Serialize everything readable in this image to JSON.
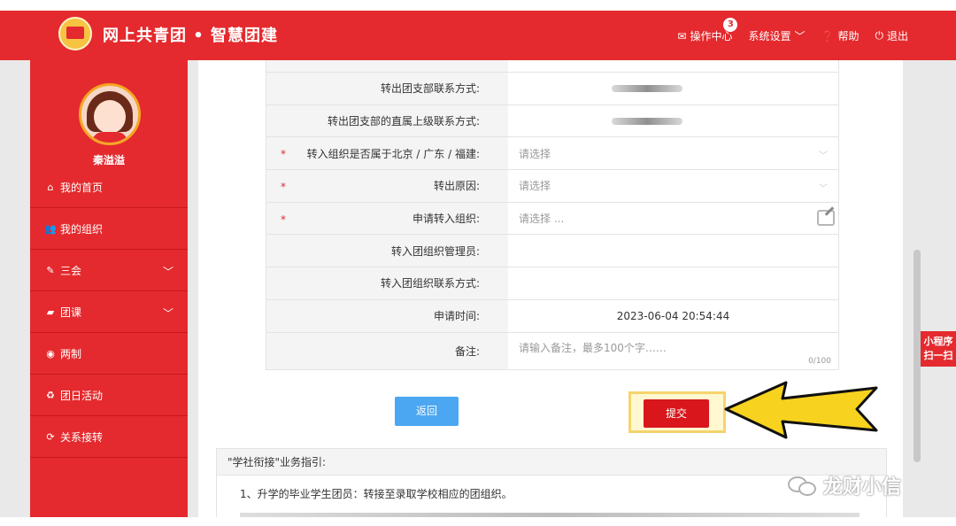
{
  "header": {
    "title": "网上共青团 • 智慧团建",
    "nav": [
      {
        "label": "操作中心",
        "badge": "3",
        "icon": "mail-icon"
      },
      {
        "label": "系统设置",
        "icon": "chevron-down-icon"
      },
      {
        "label": "帮助",
        "icon": "help-circle-icon"
      },
      {
        "label": "退出",
        "icon": "power-icon"
      }
    ]
  },
  "sidebar": {
    "username": "秦溢溢",
    "items": [
      {
        "label": "我的首页",
        "icon": "home-icon"
      },
      {
        "label": "我的组织",
        "icon": "users-icon"
      },
      {
        "label": "三会",
        "icon": "edit-square-icon"
      },
      {
        "label": "团课",
        "icon": "folder-open-icon"
      },
      {
        "label": "两制",
        "icon": "target-icon"
      },
      {
        "label": "团日活动",
        "icon": "recycle-icon"
      },
      {
        "label": "关系接转",
        "icon": "refresh-icon"
      }
    ]
  },
  "form": {
    "rows": [
      {
        "label": "转出团支部联系方式:"
      },
      {
        "label": "转出团支部的直属上级联系方式:"
      },
      {
        "label": "转入组织是否属于北京 / 广东 / 福建:",
        "value": "请选择"
      },
      {
        "label": "转出原因:",
        "value": "请选择"
      },
      {
        "label": "申请转入组织:",
        "value": "请选择 ..."
      },
      {
        "label": "转入团组织管理员:"
      },
      {
        "label": "转入团组织联系方式:"
      },
      {
        "label": "申请时间:",
        "value": "2023-06-04 20:54:44"
      },
      {
        "label": "备注:",
        "placeholder": "请输入备注，最多100个字……",
        "counter": "0/100"
      }
    ],
    "required_mark": "*"
  },
  "buttons": {
    "back": "返回",
    "submit": "提交"
  },
  "guide": {
    "title": "\"学社衔接\"业务指引:",
    "line1": "1、升学的毕业学生团员：转接至录取学校相应的团组织。"
  },
  "mini_program": {
    "line1": "小程序",
    "line2": "扫一扫"
  },
  "watermark": "龙财小信",
  "colors": {
    "brand_red": "#e42a2e",
    "back_blue": "#4ba7f1",
    "arrow_yellow": "#f7d21e"
  }
}
